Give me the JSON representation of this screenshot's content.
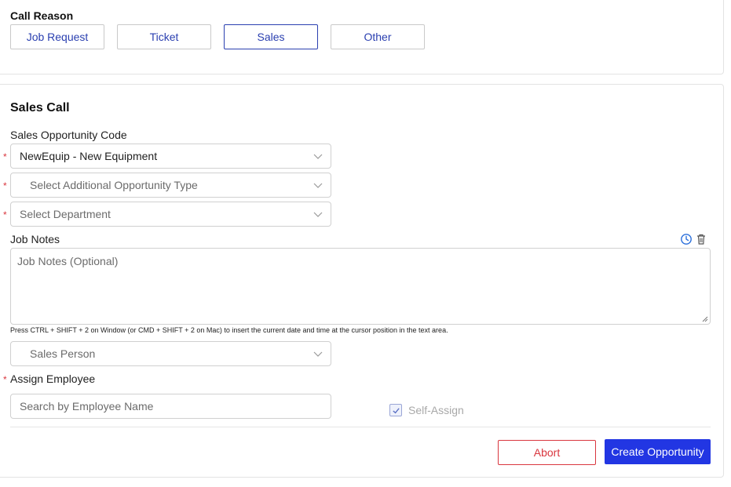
{
  "call_reason": {
    "label": "Call Reason",
    "options": [
      "Job Request",
      "Ticket",
      "Sales",
      "Other"
    ],
    "selected": "Sales"
  },
  "sales_call": {
    "title": "Sales Call",
    "opportunity_code_label": "Sales Opportunity Code",
    "opportunity_code_value": "NewEquip - New Equipment",
    "additional_type_placeholder": "Select Additional Opportunity Type",
    "department_placeholder": "Select Department",
    "job_notes_label": "Job Notes",
    "job_notes_placeholder": "Job Notes (Optional)",
    "shortcut_hint": "Press CTRL + SHIFT + 2 on Window (or CMD + SHIFT + 2 on Mac) to insert the current date and time at the cursor position in the text area.",
    "sales_person_placeholder": "Sales Person",
    "assign_employee_label": "Assign Employee",
    "employee_search_placeholder": "Search by Employee Name",
    "self_assign_label": "Self-Assign",
    "self_assign_checked": true,
    "required_marker": "*"
  },
  "actions": {
    "abort_label": "Abort",
    "create_label": "Create Opportunity"
  },
  "icons": {
    "clock": "clock-icon",
    "trash": "trash-icon",
    "chevron": "chevron-down-icon",
    "check": "check-icon"
  },
  "colors": {
    "accent": "#2236e3",
    "link": "#2a3fb0",
    "danger": "#d9363e"
  }
}
